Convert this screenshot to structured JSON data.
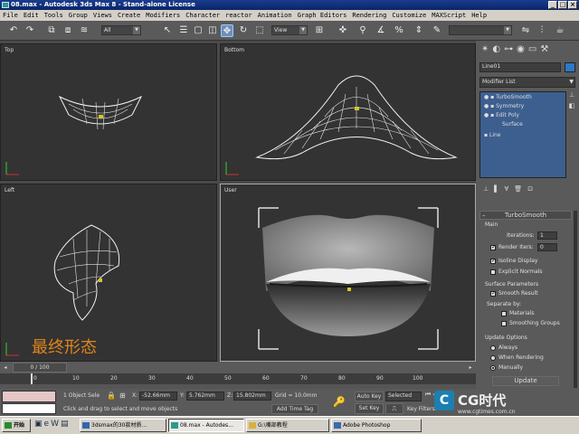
{
  "window": {
    "title": "08.max - Autodesk 3ds Max 8 - Stand-alone License"
  },
  "menu": [
    "File",
    "Edit",
    "Tools",
    "Group",
    "Views",
    "Create",
    "Modifiers",
    "Character",
    "reactor",
    "Animation",
    "Graph Editors",
    "Rendering",
    "Customize",
    "MAXScript",
    "Help"
  ],
  "toolbar": {
    "selection_filter": "All",
    "ref_coord": "View"
  },
  "viewports": {
    "top": "Top",
    "bottom": "Bottom",
    "left": "Left",
    "user": "User",
    "caption": "最终形态"
  },
  "panel": {
    "object_name": "Line01",
    "modifier_list": "Modifier List",
    "stack": [
      "TurboSmooth",
      "Symmetry",
      "Edit Poly",
      "Surface",
      "Line"
    ],
    "rollout_title": "TurboSmooth",
    "main_label": "Main",
    "iterations_label": "Iterations:",
    "iterations_value": "1",
    "render_iters_label": "Render Iters:",
    "render_iters_value": "0",
    "isoline_display": "Isoline Display",
    "explicit_normals": "Explicit Normals",
    "surface_params": "Surface Parameters",
    "smooth_result": "Smooth Result",
    "separate_by": "Separate by:",
    "materials": "Materials",
    "smoothing_groups": "Smoothing Groups",
    "update_options": "Update Options",
    "always": "Always",
    "when_rendering": "When Rendering",
    "manually": "Manually",
    "update_button": "Update"
  },
  "timeline": {
    "frame": "0 / 100",
    "ticks": [
      "0",
      "10",
      "20",
      "30",
      "40",
      "50",
      "60",
      "70",
      "80",
      "90",
      "100"
    ]
  },
  "status": {
    "selected": "1 Object Sele",
    "x": "-52.66mm",
    "y": "5.762mm",
    "z": "15.802mm",
    "grid": "Grid = 10.0mm",
    "hint": "Click and drag to select and move objects",
    "add_time_tag": "Add Time Tag",
    "auto_key": "Auto Key",
    "selected_dd": "Selected",
    "set_key": "Set Key",
    "key_filters": "Key Filters..."
  },
  "taskbar": {
    "start": "开始",
    "tasks": [
      "3dsmax的30款材质...",
      "08.max - Autodes...",
      "G:\\嘴部教程",
      "Adobe Photoshop"
    ]
  },
  "watermark": {
    "brand": "CG时代",
    "url": "www.cgtimes.com.cn"
  },
  "colors": {
    "selection_blue": "#6f8fb8",
    "caption_orange": "#e0841c",
    "title_blue": "#0a2468",
    "stack_blue": "#3d5f8f"
  }
}
